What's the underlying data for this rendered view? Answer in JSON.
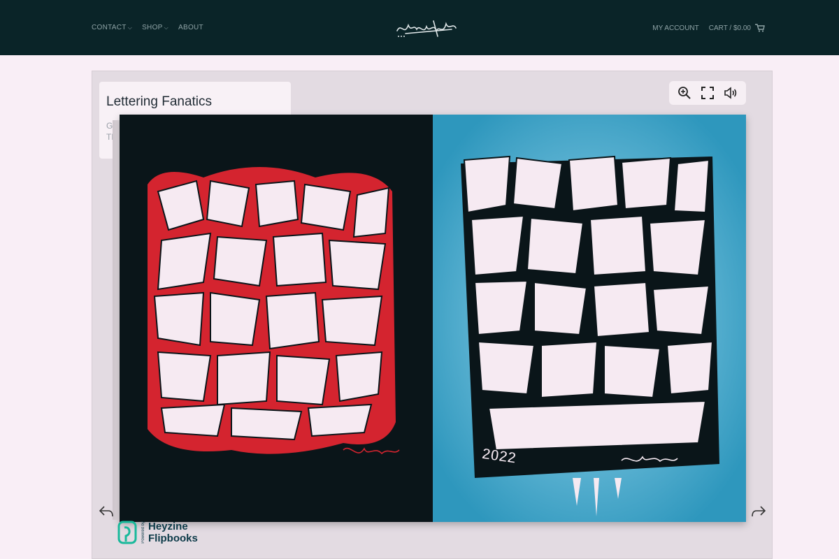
{
  "header": {
    "nav_left": [
      {
        "label": "CONTACT",
        "dropdown": true
      },
      {
        "label": "SHOP",
        "dropdown": true
      },
      {
        "label": "ABOUT",
        "dropdown": false
      }
    ],
    "account_label": "MY ACCOUNT",
    "cart_label": "CART / $0.00",
    "logo_icon": "graffiti-tag-logo",
    "cart_icon": "cart-icon"
  },
  "viewer": {
    "title": "Lettering Fanatics",
    "subtitle": "GRAFFITI TEMPLATES",
    "toolbar": [
      "zoom-in-icon",
      "fullscreen-icon",
      "sound-icon"
    ],
    "left_page": {
      "description": "red graffiti alphabet on black",
      "signature": "Tenvisel"
    },
    "right_page": {
      "year": "2022",
      "signature": "Tenvisel"
    },
    "prev_icon": "undo-arrow-icon",
    "next_icon": "redo-arrow-icon"
  },
  "branding": {
    "powered_by": "Powered by",
    "line1": "Heyzine",
    "line2": "Flipbooks"
  },
  "colors": {
    "header_bg": "#0a2428",
    "page_bg": "#f9eef6",
    "left_page_bg": "#0a1519",
    "right_page_bg": "#3aa6c9",
    "accent_red": "#d4242f"
  }
}
